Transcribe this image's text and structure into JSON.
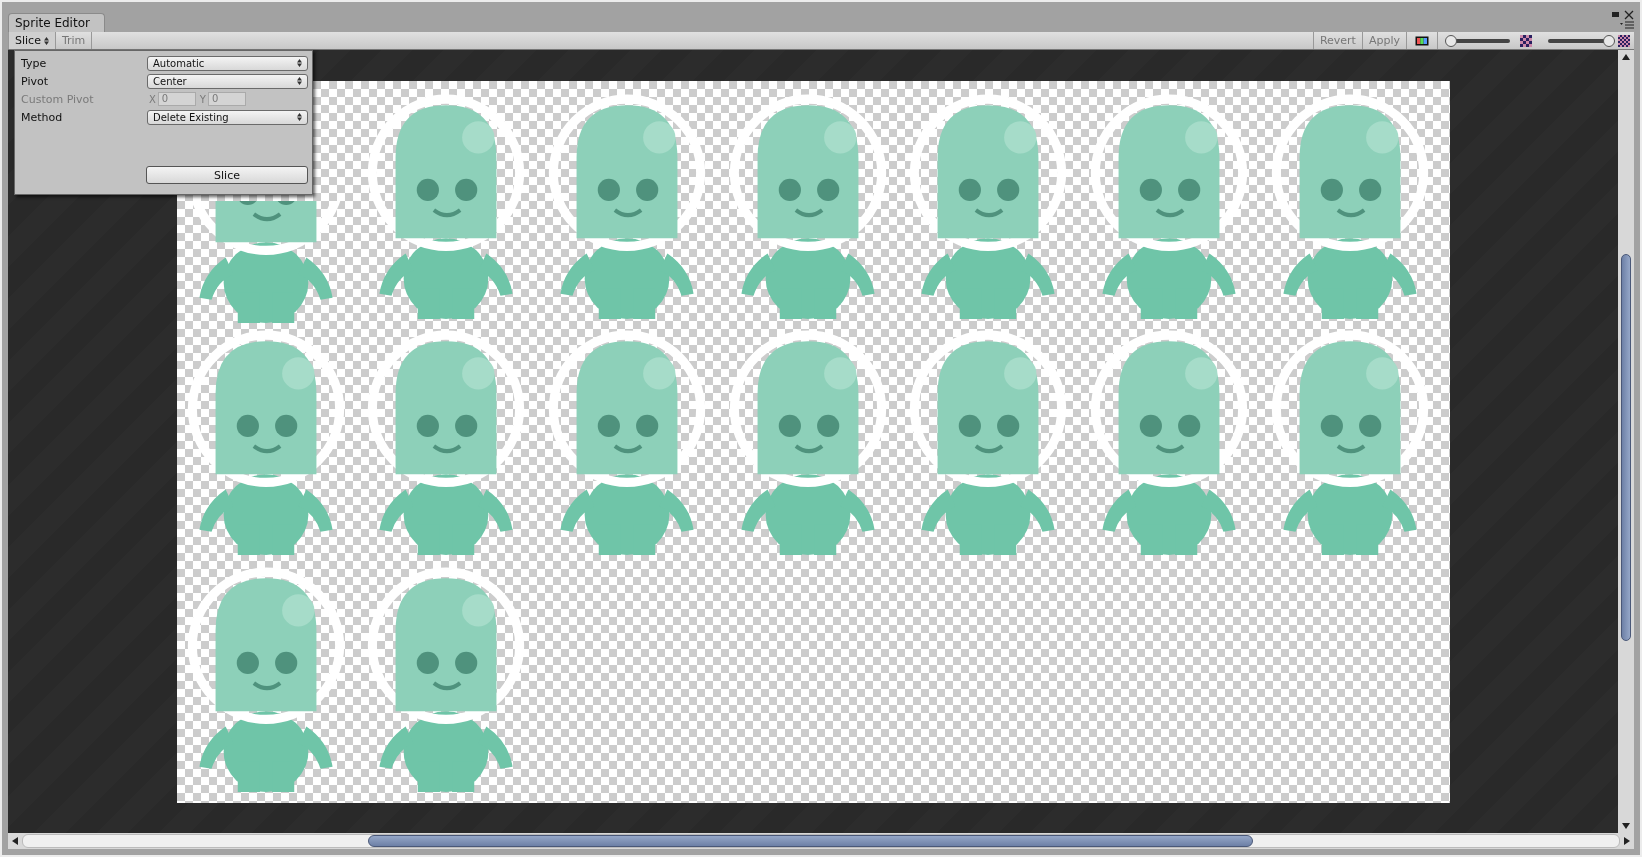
{
  "window": {
    "title": "Sprite Editor"
  },
  "toolbar": {
    "slice_menu": {
      "label": "Slice",
      "expanded": true
    },
    "trim": {
      "label": "Trim",
      "disabled": true
    },
    "revert": {
      "label": "Revert",
      "disabled": true
    },
    "apply": {
      "label": "Apply",
      "disabled": true
    },
    "zoom_slider": {
      "level": 0
    },
    "mip_slider": {
      "level": 1
    }
  },
  "slice_panel": {
    "fields": [
      {
        "kind": "dropdown",
        "label": "Type",
        "value": "Automatic",
        "disabled": false
      },
      {
        "kind": "dropdown",
        "label": "Pivot",
        "value": "Center",
        "disabled": false
      },
      {
        "kind": "xy",
        "label": "Custom Pivot",
        "x_label": "X",
        "x_value": "0",
        "y_label": "Y",
        "y_value": "0",
        "disabled": true
      },
      {
        "kind": "dropdown",
        "label": "Method",
        "value": "Delete Existing",
        "disabled": false
      }
    ],
    "button": "Slice"
  }
}
